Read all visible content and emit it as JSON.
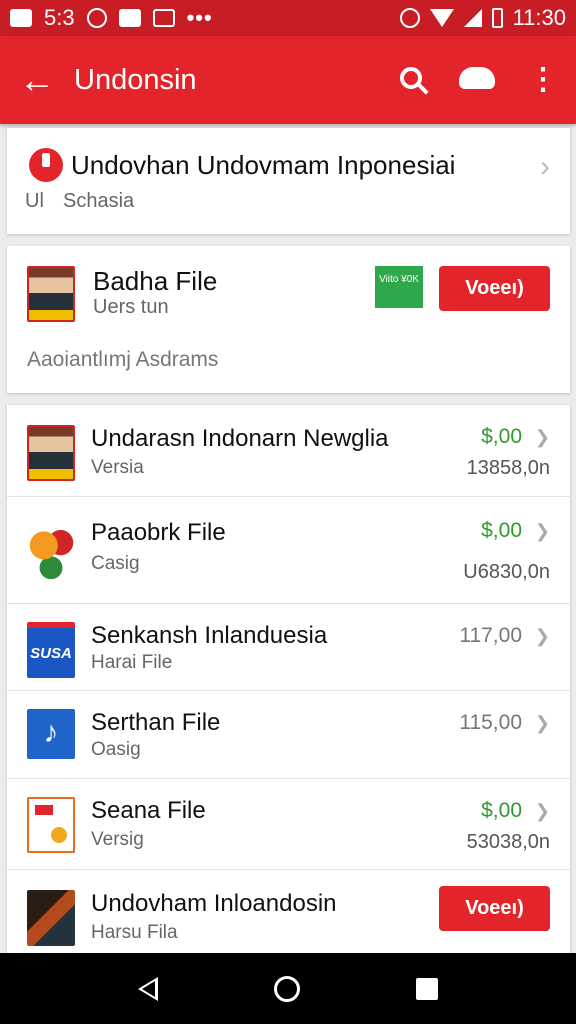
{
  "status_bar": {
    "time_left": "5:3",
    "time_right": "11:30"
  },
  "app_bar": {
    "back_icon": "arrow-left",
    "title": "Undonsin",
    "search_icon": "search",
    "cloud_icon": "cloud",
    "menu_icon": "more-vert"
  },
  "header_card": {
    "title": "Undovhan Undovmam Inponesiai",
    "label": "Ul",
    "subtitle": "Schasia"
  },
  "featured": {
    "title": "Badha File",
    "subtitle": "Uers tun",
    "badge_text": "Viito ¥0K",
    "button": "Voeeı)",
    "description": "Aaoiantlımj Asdrams"
  },
  "items": [
    {
      "title": "Undarasn Indonarn Newglia",
      "subtitle": "Versia",
      "price": "$,00",
      "size": "13858,0n",
      "thumb": "portrait"
    },
    {
      "title": "Paaobrk File",
      "subtitle": "Casig",
      "price": "$,00",
      "size": "U6830,0n",
      "thumb": "colorful"
    },
    {
      "title": "Senkansh Inlanduesia",
      "subtitle": "Harai File",
      "price": "117,00",
      "size": "",
      "thumb": "blue",
      "thumb_text": "SUSA"
    },
    {
      "title": "Serthan File",
      "subtitle": "Oasig",
      "price": "115,00",
      "size": "",
      "thumb": "music",
      "thumb_text": "♪"
    },
    {
      "title": "Seana File",
      "subtitle": "Versig",
      "price": "$,00",
      "size": "53038,0n",
      "thumb": "orange"
    },
    {
      "title": "Undovham Inloandosin",
      "subtitle": "Harsu Fila",
      "button": "Voeeı)",
      "thumb": "dark"
    }
  ],
  "colors": {
    "app_bar": "#e3242b",
    "status_bar": "#c81d25",
    "price_green": "#2f9a2f",
    "button_red": "#e3242b"
  }
}
